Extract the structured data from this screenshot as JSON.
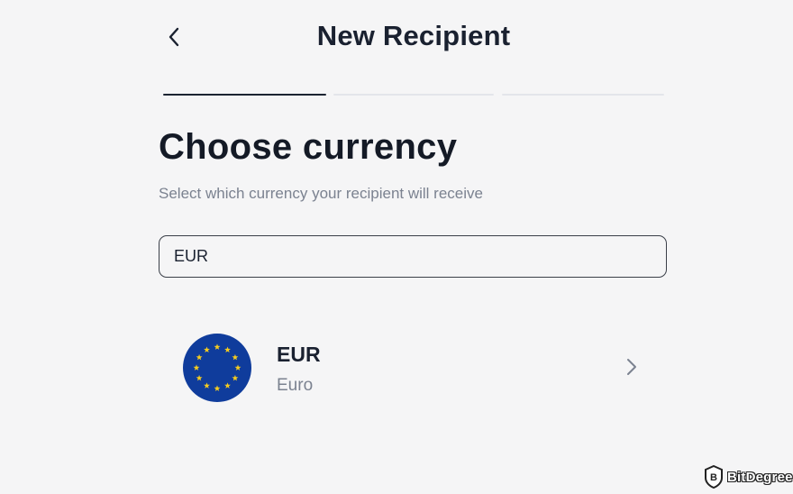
{
  "header": {
    "title": "New Recipient",
    "back_icon": "chevron-left-icon"
  },
  "progress": {
    "total_steps": 3,
    "current_step": 1
  },
  "main": {
    "heading": "Choose currency",
    "subheading": "Select which currency your recipient will receive"
  },
  "search": {
    "value": "EUR",
    "placeholder": ""
  },
  "results": [
    {
      "code": "EUR",
      "name": "Euro",
      "flag_icon": "eu-flag-icon",
      "chevron_icon": "chevron-right-icon"
    }
  ],
  "watermark": {
    "text": "BitDegree",
    "icon": "bitdegree-logo-icon"
  },
  "colors": {
    "background": "#f5f5f6",
    "text_primary": "#1a2130",
    "text_secondary": "#7b8290",
    "step_active": "#1c2431",
    "step_inactive": "#e3e5ea",
    "eu_blue": "#0f3c9c",
    "eu_star": "#f5cc1f"
  }
}
